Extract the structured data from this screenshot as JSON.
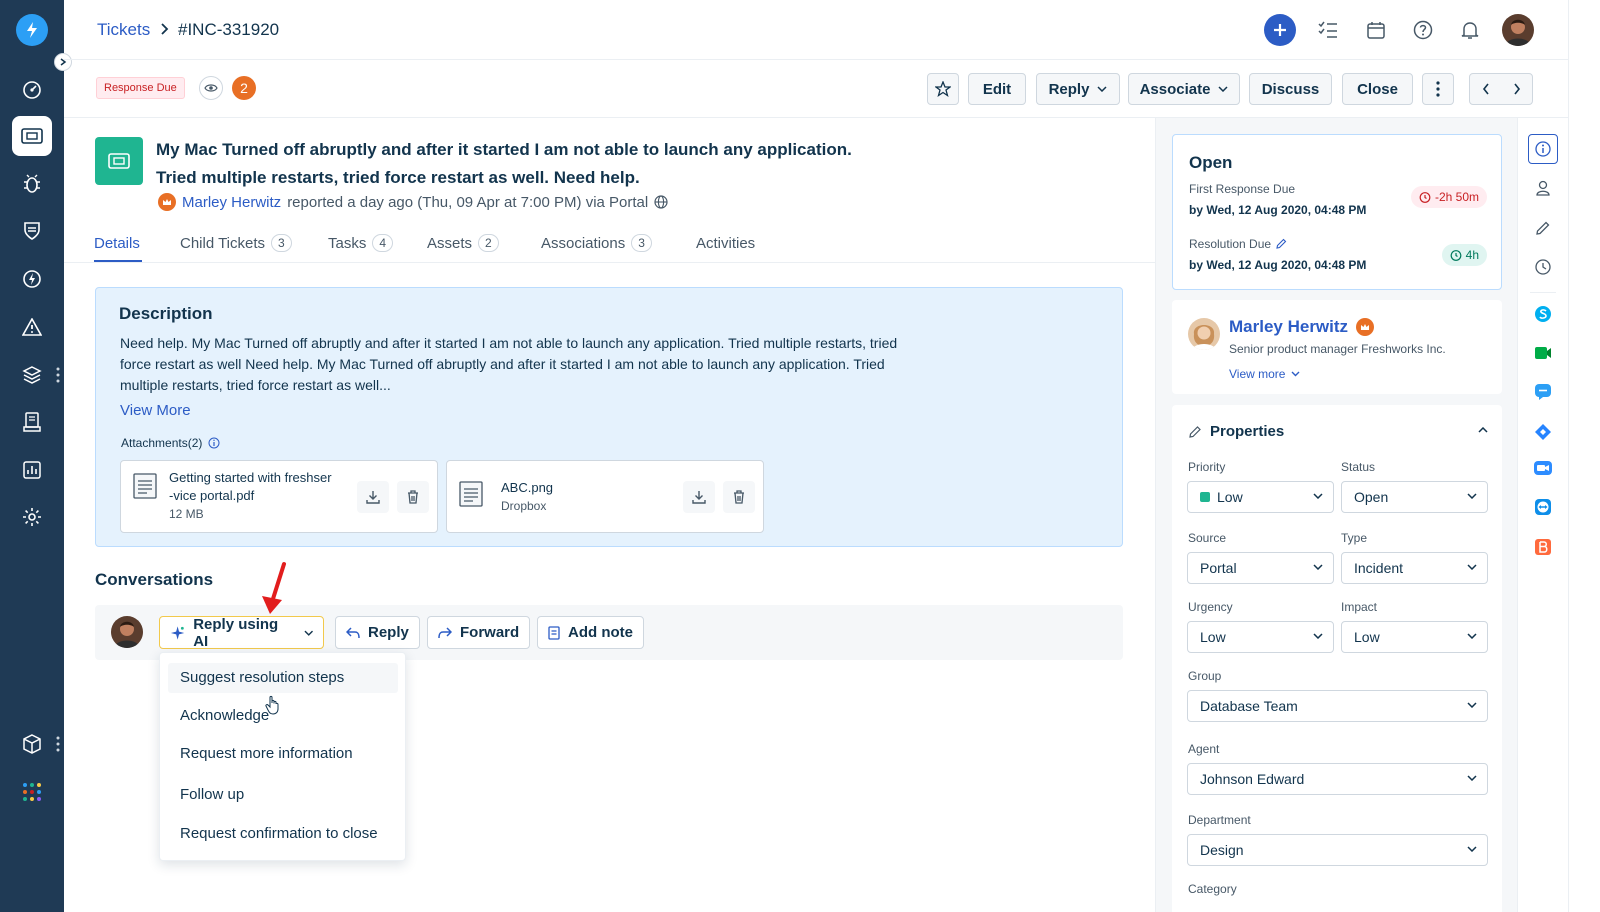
{
  "breadcrumb": {
    "parent": "Tickets",
    "current": "#INC-331920"
  },
  "toolbar": {
    "status_badge": "Response Due",
    "watcher_count": "2",
    "edit_label": "Edit",
    "reply_label": "Reply",
    "associate_label": "Associate",
    "discuss_label": "Discuss",
    "close_label": "Close"
  },
  "ticket": {
    "subject": "My Mac Turned off abruptly and after it started I am not able to launch any application. Tried multiple restarts, tried force restart as well. Need help.",
    "reporter_name": "Marley Herwitz",
    "reported_meta": "reported a day ago (Thu, 09 Apr at 7:00 PM) via Portal"
  },
  "tabs": [
    {
      "label": "Details",
      "count": ""
    },
    {
      "label": "Child Tickets",
      "count": "3"
    },
    {
      "label": "Tasks",
      "count": "4"
    },
    {
      "label": "Assets",
      "count": "2"
    },
    {
      "label": "Associations",
      "count": "3"
    },
    {
      "label": "Activities",
      "count": ""
    }
  ],
  "description": {
    "title": "Description",
    "text": "Need help. My Mac Turned off abruptly and after it started I am not able to launch any application. Tried multiple restarts, tried force restart as well Need help. My Mac Turned off abruptly and after it started I am not able to launch any application. Tried multiple restarts, tried force restart as well...",
    "view_more": "View More",
    "attachments_label": "Attachments(2)",
    "attachments": [
      {
        "name_line1": "Getting started with freshser",
        "name_line2": "-vice portal.pdf",
        "meta": "12 MB"
      },
      {
        "name_line1": "ABC.png",
        "name_line2": "",
        "meta": "Dropbox"
      }
    ]
  },
  "conversations": {
    "title": "Conversations",
    "reply_ai_label": "Reply using AI",
    "reply_label": "Reply",
    "forward_label": "Forward",
    "add_note_label": "Add note",
    "ai_menu": [
      "Suggest resolution steps",
      "Acknowledge",
      "Request more information",
      "Follow up",
      "Request confirmation to close"
    ]
  },
  "sla": {
    "status": "Open",
    "first_response_label": "First Response Due",
    "first_response_date": "by Wed, 12 Aug 2020, 04:48 PM",
    "first_response_timer": "-2h 50m",
    "resolution_label": "Resolution Due",
    "resolution_date": "by Wed, 12 Aug 2020, 04:48 PM",
    "resolution_timer": "4h"
  },
  "requester": {
    "name": "Marley Herwitz",
    "title": "Senior product manager Freshworks Inc.",
    "view_more": "View more"
  },
  "properties": {
    "title": "Properties",
    "priority_label": "Priority",
    "priority_value": "Low",
    "status_label": "Status",
    "status_value": "Open",
    "source_label": "Source",
    "source_value": "Portal",
    "type_label": "Type",
    "type_value": "Incident",
    "urgency_label": "Urgency",
    "urgency_value": "Low",
    "impact_label": "Impact",
    "impact_value": "Low",
    "group_label": "Group",
    "group_value": "Database Team",
    "agent_label": "Agent",
    "agent_value": "Johnson Edward",
    "department_label": "Department",
    "department_value": "Design",
    "category_label": "Category"
  },
  "colors": {
    "nav_bg": "#1f3a55",
    "accent": "#2c5cc5",
    "ticket_icon": "#1fb591",
    "desc_bg": "#e5f2fd",
    "alert_red": "#c82124",
    "orange": "#e86f25"
  },
  "icons": {
    "nav": [
      "logo-bolt-icon",
      "dashboard-icon",
      "tickets-icon",
      "bug-icon",
      "shield-icon",
      "bolt-icon",
      "alert-icon",
      "layers-icon",
      "assets-icon",
      "reports-icon",
      "settings-icon",
      "cube-icon",
      "apps-grid-icon"
    ],
    "top": [
      "add-icon",
      "tasks-icon",
      "calendar-icon",
      "help-icon",
      "bell-icon",
      "avatar"
    ]
  }
}
